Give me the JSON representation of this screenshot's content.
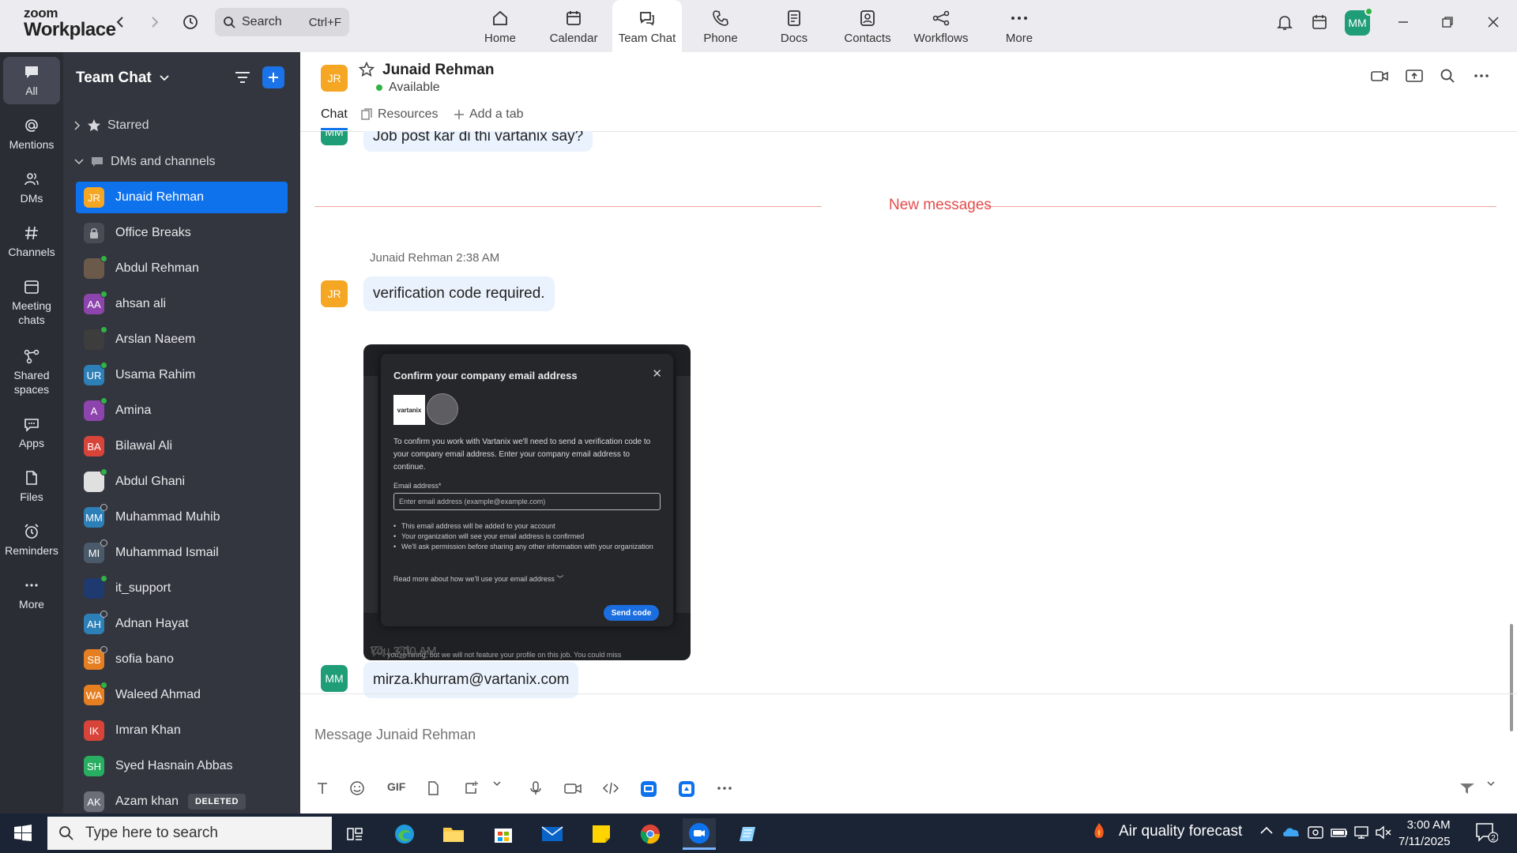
{
  "app": {
    "logo_line1": "zoom",
    "logo_line2": "Workplace"
  },
  "topbar": {
    "search_label": "Search",
    "search_shortcut": "Ctrl+F",
    "nav": [
      {
        "label": "Home",
        "icon": "home-icon"
      },
      {
        "label": "Calendar",
        "icon": "calendar-icon"
      },
      {
        "label": "Team Chat",
        "icon": "chat-icon",
        "active": true
      },
      {
        "label": "Phone",
        "icon": "phone-icon"
      },
      {
        "label": "Docs",
        "icon": "docs-icon"
      },
      {
        "label": "Contacts",
        "icon": "contacts-icon"
      },
      {
        "label": "Workflows",
        "icon": "workflows-icon"
      },
      {
        "label": "More",
        "icon": "more-icon"
      }
    ],
    "user_initials": "MM"
  },
  "rail": [
    {
      "label": "All",
      "icon": "chat-bubble-icon",
      "active": true
    },
    {
      "label": "Mentions",
      "icon": "at-icon"
    },
    {
      "label": "DMs",
      "icon": "people-icon"
    },
    {
      "label": "Channels",
      "icon": "hash-icon"
    },
    {
      "label": "Meeting chats",
      "icon": "calendar-icon"
    },
    {
      "label": "Shared spaces",
      "icon": "share-icon"
    },
    {
      "label": "Apps",
      "icon": "apps-icon"
    },
    {
      "label": "Files",
      "icon": "file-icon"
    },
    {
      "label": "Reminders",
      "icon": "alarm-icon"
    },
    {
      "label": "More",
      "icon": "more-icon"
    }
  ],
  "sidebar": {
    "title": "Team Chat",
    "starred_label": "Starred",
    "dms_label": "DMs and channels",
    "items": [
      {
        "name": "Junaid Rehman",
        "initials": "JR",
        "color": "#f5a623",
        "selected": true
      },
      {
        "name": "Office Breaks",
        "initials": "",
        "color": "#4a4c55",
        "lock": true
      },
      {
        "name": "Abdul Rehman",
        "initials": "",
        "color": "#6b5a4a",
        "status": "on"
      },
      {
        "name": "ahsan ali",
        "initials": "AA",
        "color": "#8e44ad",
        "status": "on"
      },
      {
        "name": "Arslan Naeem",
        "initials": "",
        "color": "#3d3d3d",
        "status": "on"
      },
      {
        "name": "Usama Rahim",
        "initials": "UR",
        "color": "#2d7fb8",
        "status": "on"
      },
      {
        "name": "Amina",
        "initials": "A",
        "color": "#8e44ad",
        "status": "on"
      },
      {
        "name": "Bilawal Ali",
        "initials": "BA",
        "color": "#d9443a"
      },
      {
        "name": "Abdul Ghani",
        "initials": "",
        "color": "#e0e0e0",
        "status": "on"
      },
      {
        "name": "Muhammad Muhib",
        "initials": "MM",
        "color": "#2d7fb8",
        "status": "off"
      },
      {
        "name": "Muhammad Ismail",
        "initials": "MI",
        "color": "#4a5a6a",
        "status": "off"
      },
      {
        "name": "it_support",
        "initials": "",
        "color": "#1e3a6e",
        "status": "on"
      },
      {
        "name": "Adnan Hayat",
        "initials": "AH",
        "color": "#2d7fb8",
        "status": "off"
      },
      {
        "name": "sofia bano",
        "initials": "SB",
        "color": "#e67e22",
        "status": "off"
      },
      {
        "name": "Waleed Ahmad",
        "initials": "WA",
        "color": "#e67e22",
        "status": "on"
      },
      {
        "name": "Imran Khan",
        "initials": "IK",
        "color": "#d9443a"
      },
      {
        "name": "Syed Hasnain Abbas",
        "initials": "SH",
        "color": "#27ae60"
      },
      {
        "name": "Azam khan",
        "initials": "AK",
        "color": "#6c6f7a",
        "badge": "DELETED"
      }
    ]
  },
  "chat": {
    "name": "Junaid Rehman",
    "initials": "JR",
    "status": "Available",
    "tabs": [
      {
        "label": "Chat",
        "active": true
      },
      {
        "label": "Resources",
        "icon": "resources-icon"
      },
      {
        "label": "Add a tab",
        "icon": "plus-icon"
      }
    ],
    "prev_message": "Job post kar di thi vartanix say?",
    "prev_initials": "MM",
    "new_messages_label": "New messages",
    "messages": [
      {
        "sender": "Junaid Rehman",
        "time": "2:38 AM",
        "initials": "JR",
        "text": "verification code required."
      },
      {
        "sender": "You",
        "time": "3:00 AM",
        "initials": "MM",
        "text": "mirza.khurram@vartanix.com"
      }
    ],
    "attachment": {
      "title": "Confirm your company email address",
      "logo_text": "vartanix",
      "body": "To confirm you work with Vartanix we'll need to send a verification code to your company email address. Enter your company email address to continue.",
      "field_label": "Email address*",
      "field_placeholder": "Enter email address (example@example.com)",
      "bullets": [
        "This email address will be added to your account",
        "Your organization will see your email address is confirmed",
        "We'll ask permission before sharing any other information with your organization"
      ],
      "more_link": "Read more about how we'll use your email address",
      "button": "Send code",
      "footer": "you're hiring, but we will not feature your profile on this job. You could miss"
    },
    "composer_placeholder": "Message Junaid Rehman",
    "tools": [
      "format-icon",
      "emoji-icon",
      "GIF",
      "file-icon",
      "screenshot-icon",
      "dropdown-icon",
      "mic-icon",
      "video-icon",
      "code-icon",
      "app1-icon",
      "app2-icon",
      "more-icon"
    ]
  },
  "taskbar": {
    "search_placeholder": "Type here to search",
    "weather": "Air quality forecast",
    "time": "3:00 AM",
    "date": "7/11/2025",
    "notifications": "2"
  }
}
